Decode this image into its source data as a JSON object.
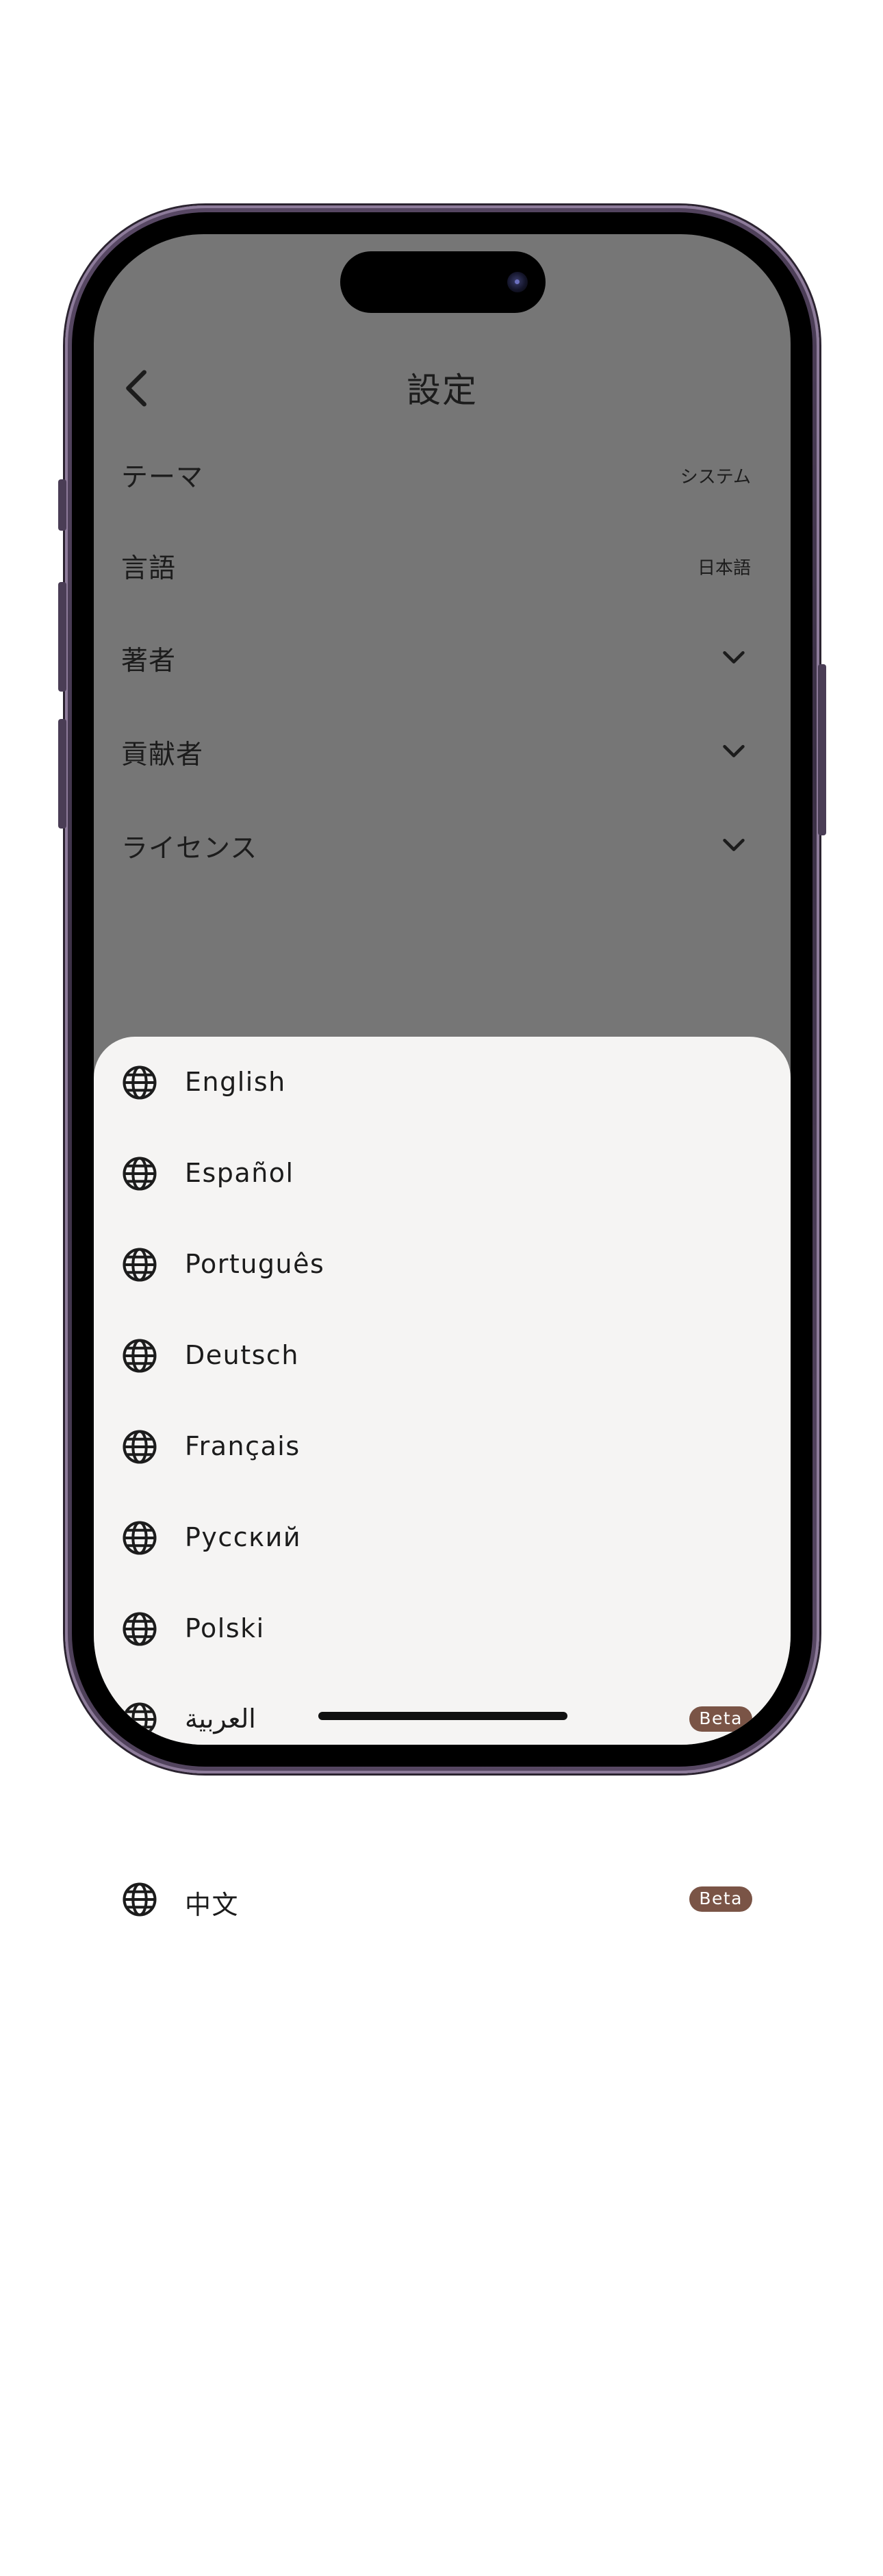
{
  "header": {
    "title": "設定",
    "back_icon": "chevron-left-icon"
  },
  "settings": [
    {
      "label": "テーマ",
      "value": "システム",
      "control": "value"
    },
    {
      "label": "言語",
      "value": "日本語",
      "control": "value"
    },
    {
      "label": "著者",
      "control": "chevron-down-icon"
    },
    {
      "label": "貢献者",
      "control": "chevron-down-icon"
    },
    {
      "label": "ライセンス",
      "control": "chevron-down-icon"
    }
  ],
  "language_sheet": {
    "item_icon": "globe-icon",
    "items": [
      {
        "label": "English"
      },
      {
        "label": "Español"
      },
      {
        "label": "Português"
      },
      {
        "label": "Deutsch"
      },
      {
        "label": "Français"
      },
      {
        "label": "Русский"
      },
      {
        "label": "Polski"
      },
      {
        "label": "العربية",
        "badge": "Beta"
      },
      {
        "label": "中文",
        "badge": "Beta"
      }
    ]
  },
  "colors": {
    "dimmed_background": "#767676",
    "sheet_background": "#f5f4f3",
    "badge_background": "#7a5446",
    "text": "#1c1c1c"
  }
}
